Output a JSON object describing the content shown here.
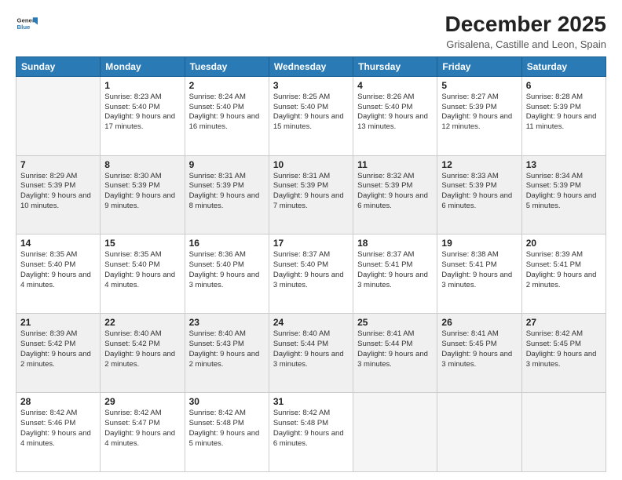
{
  "logo": {
    "line1": "General",
    "line2": "Blue"
  },
  "title": "December 2025",
  "subtitle": "Grisalena, Castille and Leon, Spain",
  "days_of_week": [
    "Sunday",
    "Monday",
    "Tuesday",
    "Wednesday",
    "Thursday",
    "Friday",
    "Saturday"
  ],
  "weeks": [
    [
      {
        "day": "",
        "info": ""
      },
      {
        "day": "1",
        "info": "Sunrise: 8:23 AM\nSunset: 5:40 PM\nDaylight: 9 hours\nand 17 minutes."
      },
      {
        "day": "2",
        "info": "Sunrise: 8:24 AM\nSunset: 5:40 PM\nDaylight: 9 hours\nand 16 minutes."
      },
      {
        "day": "3",
        "info": "Sunrise: 8:25 AM\nSunset: 5:40 PM\nDaylight: 9 hours\nand 15 minutes."
      },
      {
        "day": "4",
        "info": "Sunrise: 8:26 AM\nSunset: 5:40 PM\nDaylight: 9 hours\nand 13 minutes."
      },
      {
        "day": "5",
        "info": "Sunrise: 8:27 AM\nSunset: 5:39 PM\nDaylight: 9 hours\nand 12 minutes."
      },
      {
        "day": "6",
        "info": "Sunrise: 8:28 AM\nSunset: 5:39 PM\nDaylight: 9 hours\nand 11 minutes."
      }
    ],
    [
      {
        "day": "7",
        "info": "Sunrise: 8:29 AM\nSunset: 5:39 PM\nDaylight: 9 hours\nand 10 minutes."
      },
      {
        "day": "8",
        "info": "Sunrise: 8:30 AM\nSunset: 5:39 PM\nDaylight: 9 hours\nand 9 minutes."
      },
      {
        "day": "9",
        "info": "Sunrise: 8:31 AM\nSunset: 5:39 PM\nDaylight: 9 hours\nand 8 minutes."
      },
      {
        "day": "10",
        "info": "Sunrise: 8:31 AM\nSunset: 5:39 PM\nDaylight: 9 hours\nand 7 minutes."
      },
      {
        "day": "11",
        "info": "Sunrise: 8:32 AM\nSunset: 5:39 PM\nDaylight: 9 hours\nand 6 minutes."
      },
      {
        "day": "12",
        "info": "Sunrise: 8:33 AM\nSunset: 5:39 PM\nDaylight: 9 hours\nand 6 minutes."
      },
      {
        "day": "13",
        "info": "Sunrise: 8:34 AM\nSunset: 5:39 PM\nDaylight: 9 hours\nand 5 minutes."
      }
    ],
    [
      {
        "day": "14",
        "info": "Sunrise: 8:35 AM\nSunset: 5:40 PM\nDaylight: 9 hours\nand 4 minutes."
      },
      {
        "day": "15",
        "info": "Sunrise: 8:35 AM\nSunset: 5:40 PM\nDaylight: 9 hours\nand 4 minutes."
      },
      {
        "day": "16",
        "info": "Sunrise: 8:36 AM\nSunset: 5:40 PM\nDaylight: 9 hours\nand 3 minutes."
      },
      {
        "day": "17",
        "info": "Sunrise: 8:37 AM\nSunset: 5:40 PM\nDaylight: 9 hours\nand 3 minutes."
      },
      {
        "day": "18",
        "info": "Sunrise: 8:37 AM\nSunset: 5:41 PM\nDaylight: 9 hours\nand 3 minutes."
      },
      {
        "day": "19",
        "info": "Sunrise: 8:38 AM\nSunset: 5:41 PM\nDaylight: 9 hours\nand 3 minutes."
      },
      {
        "day": "20",
        "info": "Sunrise: 8:39 AM\nSunset: 5:41 PM\nDaylight: 9 hours\nand 2 minutes."
      }
    ],
    [
      {
        "day": "21",
        "info": "Sunrise: 8:39 AM\nSunset: 5:42 PM\nDaylight: 9 hours\nand 2 minutes."
      },
      {
        "day": "22",
        "info": "Sunrise: 8:40 AM\nSunset: 5:42 PM\nDaylight: 9 hours\nand 2 minutes."
      },
      {
        "day": "23",
        "info": "Sunrise: 8:40 AM\nSunset: 5:43 PM\nDaylight: 9 hours\nand 2 minutes."
      },
      {
        "day": "24",
        "info": "Sunrise: 8:40 AM\nSunset: 5:44 PM\nDaylight: 9 hours\nand 3 minutes."
      },
      {
        "day": "25",
        "info": "Sunrise: 8:41 AM\nSunset: 5:44 PM\nDaylight: 9 hours\nand 3 minutes."
      },
      {
        "day": "26",
        "info": "Sunrise: 8:41 AM\nSunset: 5:45 PM\nDaylight: 9 hours\nand 3 minutes."
      },
      {
        "day": "27",
        "info": "Sunrise: 8:42 AM\nSunset: 5:45 PM\nDaylight: 9 hours\nand 3 minutes."
      }
    ],
    [
      {
        "day": "28",
        "info": "Sunrise: 8:42 AM\nSunset: 5:46 PM\nDaylight: 9 hours\nand 4 minutes."
      },
      {
        "day": "29",
        "info": "Sunrise: 8:42 AM\nSunset: 5:47 PM\nDaylight: 9 hours\nand 4 minutes."
      },
      {
        "day": "30",
        "info": "Sunrise: 8:42 AM\nSunset: 5:48 PM\nDaylight: 9 hours\nand 5 minutes."
      },
      {
        "day": "31",
        "info": "Sunrise: 8:42 AM\nSunset: 5:48 PM\nDaylight: 9 hours\nand 6 minutes."
      },
      {
        "day": "",
        "info": ""
      },
      {
        "day": "",
        "info": ""
      },
      {
        "day": "",
        "info": ""
      }
    ]
  ]
}
